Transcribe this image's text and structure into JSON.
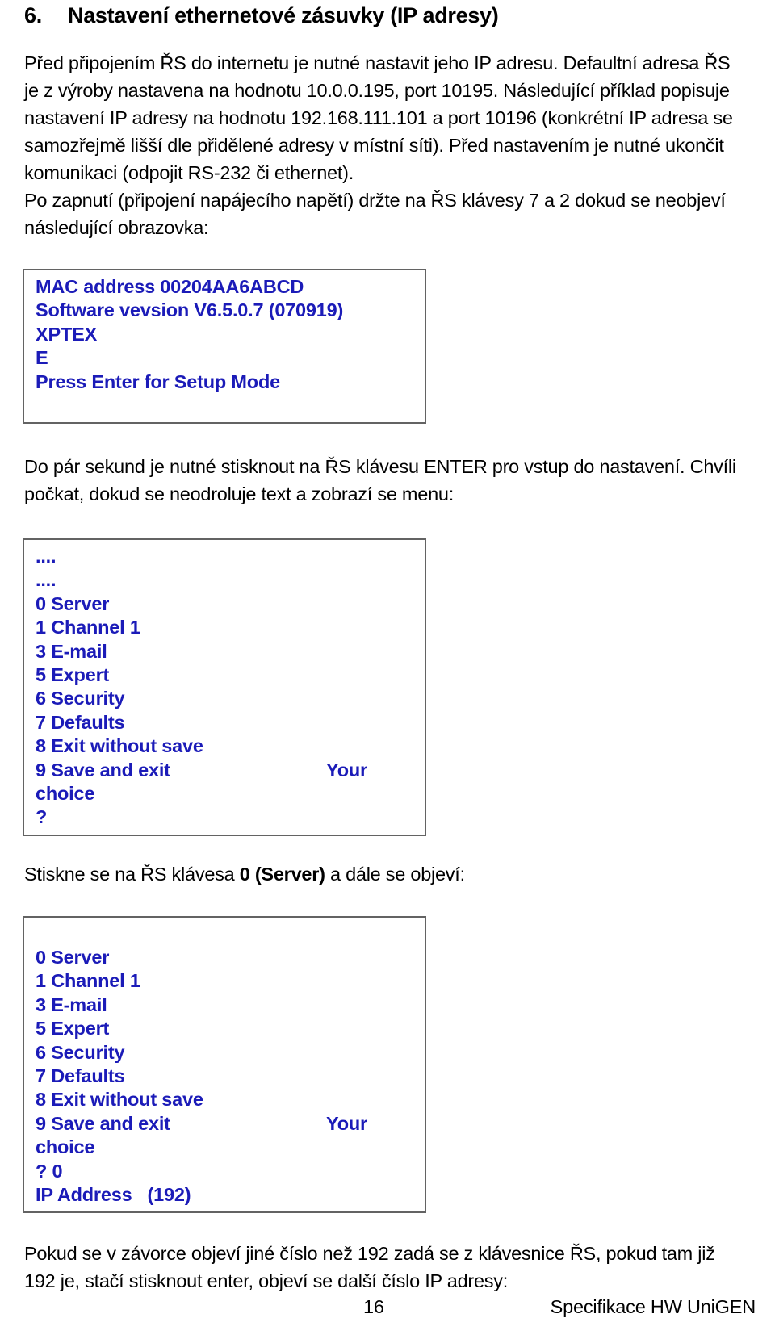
{
  "heading": {
    "number": "6.",
    "title": "Nastavení ethernetové zásuvky (IP adresy)"
  },
  "paragraphs": {
    "intro_1": "Před připojením ŘS do internetu je nutné nastavit jeho IP adresu. Defaultní adresa ŘS je z výroby nastavena na hodnotu 10.0.0.195, port 10195. Následující příklad popisuje nastavení IP adresy na hodnotu 192.168.111.101 a port 10196 (konkrétní IP adresa se samozřejmě lišší dle přidělené adresy v místní síti). Před nastavením je nutné ukončit komunikaci (odpojit RS-232 či ethernet).",
    "intro_2": "Po zapnutí (připojení napájecího napětí) držte na ŘS klávesy 7 a 2 dokud se neobjeví následující obrazovka:",
    "after_box1": "Do pár sekund je nutné stisknout na ŘS klávesu ENTER pro vstup do nastavení. Chvíli počkat, dokud se neodroluje text a zobrazí se menu:",
    "after_box2_pre": "Stiskne se na ŘS klávesa ",
    "after_box2_bold": "0 (Server)",
    "after_box2_post": " a dále se objeví:",
    "after_box3": "Pokud se v závorce objeví jiné číslo než 192 zadá se z klávesnice ŘS, pokud tam již 192 je, stačí stisknout enter, objeví se další číslo IP adresy:"
  },
  "terminal_box_1": {
    "lines": [
      "MAC address 00204AA6ABCD",
      "Software vevsion V6.5.0.7 (070919)",
      "XPTEX",
      "E",
      "Press Enter for Setup Mode"
    ]
  },
  "terminal_box_2": {
    "lines": [
      "....",
      "....",
      "0 Server",
      "1 Channel 1",
      "3 E-mail",
      "5 Expert",
      "6 Security",
      "7 Defaults",
      "8 Exit without save"
    ],
    "save_line_left": "9 Save and exit",
    "save_line_right": "Your",
    "tail_lines": [
      "choice",
      "?"
    ]
  },
  "terminal_box_3": {
    "lines": [
      "0 Server",
      "1 Channel 1",
      "3 E-mail",
      "5 Expert",
      "6 Security",
      "7 Defaults",
      "8 Exit without save"
    ],
    "save_line_left": "9 Save and exit",
    "save_line_right": "Your",
    "tail_lines": [
      "choice",
      "? 0",
      "IP Address   (192)"
    ]
  },
  "footer": {
    "page_number": "16",
    "document": "Specifikace HW UniGEN"
  },
  "colors": {
    "terminal_text": "#1b1bb8",
    "terminal_border": "#636363",
    "body_text": "#000000",
    "page_background": "#ffffff"
  }
}
